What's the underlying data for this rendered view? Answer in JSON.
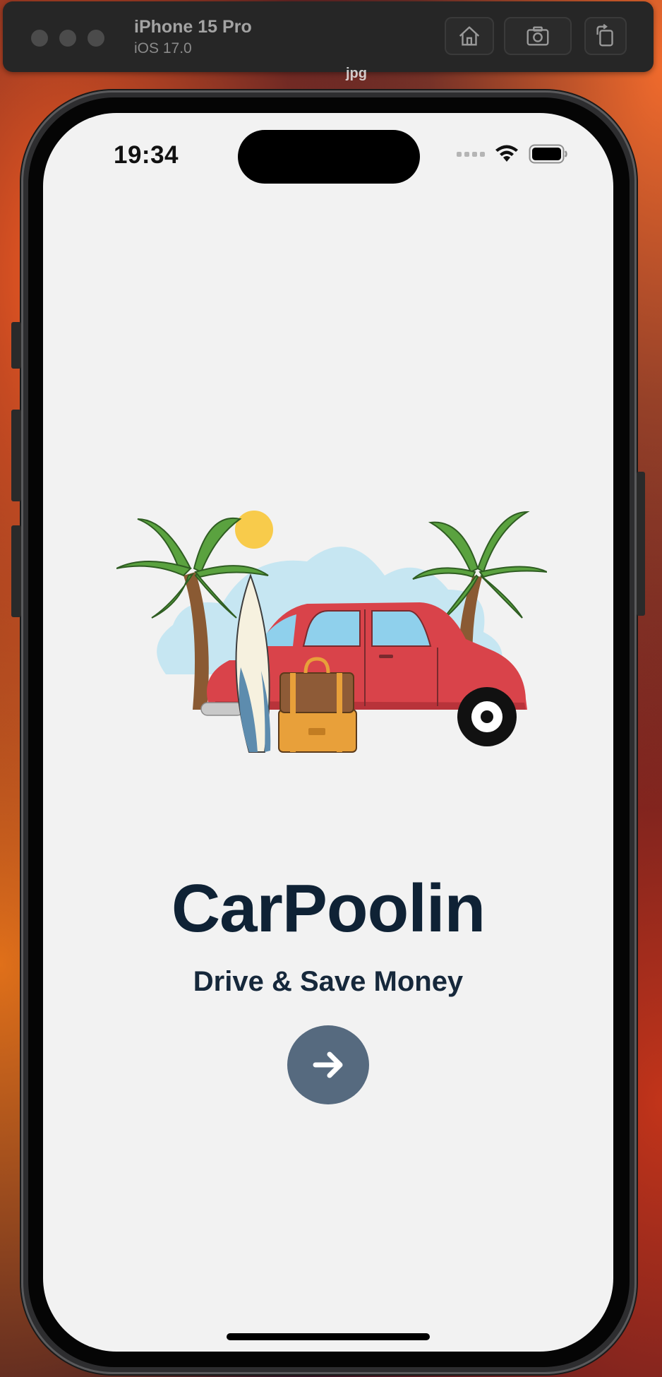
{
  "simulator": {
    "device_name": "iPhone 15 Pro",
    "os_version": "iOS 17.0",
    "file_label": "jpg",
    "toolbar_icons": [
      "home-icon",
      "screenshot-icon",
      "rotate-icon"
    ]
  },
  "status_bar": {
    "time": "19:34",
    "icons": [
      "cellular-signal-icon",
      "wifi-icon",
      "battery-icon"
    ]
  },
  "welcome": {
    "illustration": "car-beach-illustration",
    "title": "CarPoolin",
    "subtitle": "Drive & Save Money",
    "next_icon": "arrow-right-icon"
  },
  "colors": {
    "screen_bg": "#f2f2f2",
    "title": "#0f2235",
    "button_bg": "#566a7f",
    "car_red": "#d9434a"
  }
}
